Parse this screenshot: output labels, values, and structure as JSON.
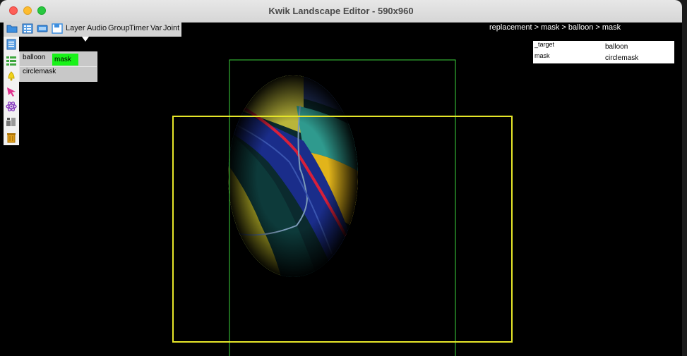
{
  "window": {
    "title": "Kwik Landscape Editor - 590x960"
  },
  "toolbar": {
    "icons": [
      "folder-icon",
      "list-tree-icon",
      "image-icon",
      "save-icon"
    ],
    "menu": [
      "Layer",
      "Audio",
      "Group",
      "Timer",
      "Var",
      "Joint"
    ]
  },
  "sidebar": {
    "icons": [
      "page-icon",
      "list-icon",
      "bell-icon",
      "pointer-icon",
      "atom-icon",
      "tools-icon",
      "trash-icon"
    ]
  },
  "layers": {
    "items": [
      {
        "label": "balloon",
        "child": "mask"
      },
      {
        "label": "circlemask"
      }
    ]
  },
  "breadcrumb": "replacement  > mask > balloon  > mask",
  "properties": [
    {
      "key": "_target",
      "value": "balloon"
    },
    {
      "key": "mask",
      "value": "circlemask"
    }
  ],
  "colors": {
    "selection_green": "#18f218",
    "frame_green": "#3cd23c",
    "frame_yellow": "#e6e629"
  }
}
